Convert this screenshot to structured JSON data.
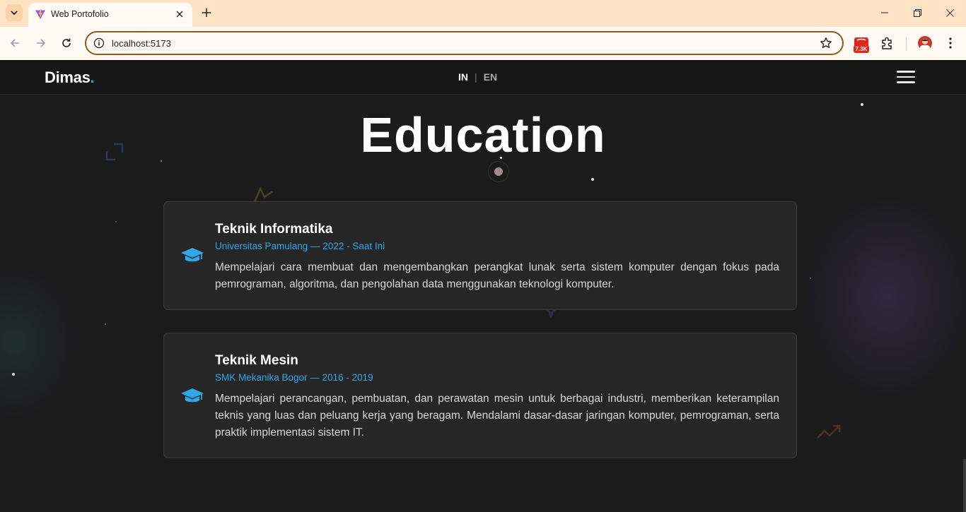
{
  "browser": {
    "tab_title": "Web Portofolio",
    "url": "localhost:5173",
    "extension_badge": "7.3K"
  },
  "nav": {
    "logo": "Dimas",
    "logo_dot": ".",
    "lang_active": "IN",
    "lang_separator": "|",
    "lang_other": "EN"
  },
  "section": {
    "title": "Education"
  },
  "education": [
    {
      "title": "Teknik Informatika",
      "subtitle": "Universitas Pamulang — 2022 - Saat Ini",
      "description": "Mempelajari cara membuat dan mengembangkan perangkat lunak serta sistem komputer dengan fokus pada pemrograman, algoritma, dan pengolahan data menggunakan teknologi komputer.",
      "icon": "graduation-cap-icon"
    },
    {
      "title": "Teknik Mesin",
      "subtitle": "SMK Mekanika Bogor — 2016 - 2019",
      "description": "Mempelajari perancangan, pembuatan, dan perawatan mesin untuk berbagai industri, memberikan keterampilan teknis yang luas dan peluang kerja yang beragam. Mendalami dasar-dasar jaringan komputer, pemrograman, serta praktik implementasi sistem IT.",
      "icon": "graduation-cap-icon"
    }
  ],
  "colors": {
    "accent": "#2ea8e6",
    "background": "#1b1b1c",
    "card": "#262627",
    "tabbar": "#fde2c4",
    "omnibox_border": "#8a5a1e"
  }
}
